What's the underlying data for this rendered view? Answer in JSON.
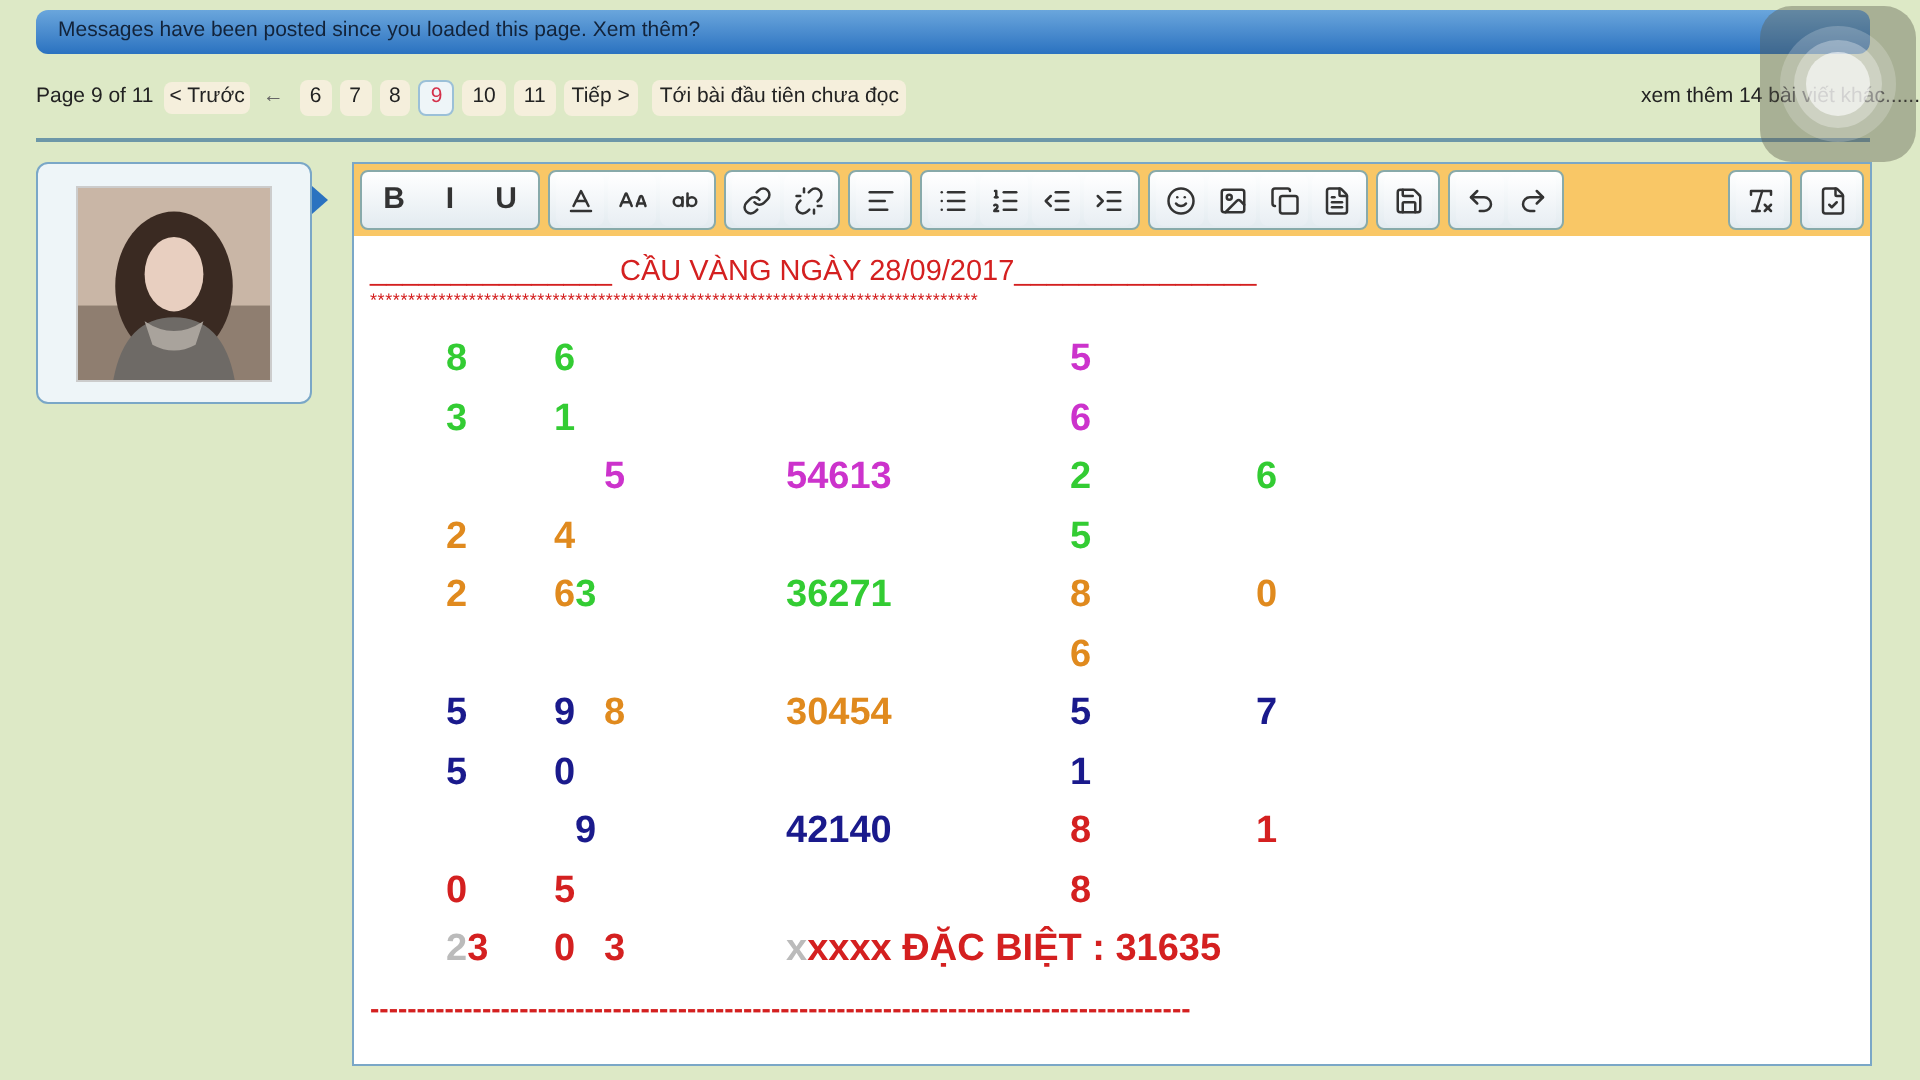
{
  "notice": {
    "text": "Messages have been posted since you loaded this page. Xem thêm?"
  },
  "pagination": {
    "label": "Page 9 of 11",
    "prev": "< Trước",
    "ellipsis": "←",
    "pages": [
      {
        "label": "6",
        "selected": false
      },
      {
        "label": "7",
        "selected": false
      },
      {
        "label": "8",
        "selected": false
      },
      {
        "label": "9",
        "selected": true
      },
      {
        "label": "10",
        "selected": false
      },
      {
        "label": "11",
        "selected": false
      }
    ],
    "next": "Tiếp >",
    "first_unread": "Tới bài đầu tiên chưa đọc",
    "more": "xem thêm 14 bài viết khác......"
  },
  "toolbar": {
    "format_buttons": [
      "B",
      "I",
      "U"
    ]
  },
  "post": {
    "title": "_______________ CẦU VÀNG NGÀY 28/09/2017_______________",
    "stars": "********************************************************************************",
    "rows": [
      {
        "column_1": [
          {
            "text": "8",
            "color": "#33cc33"
          }
        ],
        "column_2": [
          {
            "text": "6",
            "color": "#33cc33"
          }
        ],
        "column_5": [
          {
            "text": "5",
            "color": "#cc33cc"
          }
        ]
      },
      {
        "column_1": [
          {
            "text": "3",
            "color": "#33cc33"
          }
        ],
        "column_2": [
          {
            "text": "1",
            "color": "#33cc33"
          }
        ],
        "column_5": [
          {
            "text": "6",
            "color": "#cc33cc"
          }
        ]
      },
      {
        "column_3": [
          {
            "text": "5",
            "color": "#cc33cc"
          }
        ],
        "column_4": [
          {
            "text": "54613",
            "color": "#cc33cc"
          }
        ],
        "column_5": [
          {
            "text": "2",
            "color": "#33cc33"
          }
        ],
        "column_6": [
          {
            "text": "6",
            "color": "#33cc33"
          }
        ]
      },
      {
        "column_1": [
          {
            "text": "2",
            "color": "#e08a1e"
          }
        ],
        "column_2": [
          {
            "text": "4",
            "color": "#e08a1e"
          }
        ],
        "column_5": [
          {
            "text": "5",
            "color": "#33cc33"
          }
        ]
      },
      {
        "column_1": [
          {
            "text": "2",
            "color": "#e08a1e"
          }
        ],
        "column_2": [
          {
            "text": "6",
            "color": "#e08a1e"
          },
          {
            "text": "3",
            "color": "#33cc33"
          }
        ],
        "column_4": [
          {
            "text": "36271",
            "color": "#33cc33"
          }
        ],
        "column_5": [
          {
            "text": "8",
            "color": "#e08a1e"
          }
        ],
        "column_6": [
          {
            "text": "0",
            "color": "#e08a1e"
          }
        ]
      },
      {
        "column_5": [
          {
            "text": "6",
            "color": "#e08a1e"
          }
        ]
      },
      {
        "column_1": [
          {
            "text": "5",
            "color": "#1a1a8c"
          }
        ],
        "column_2": [
          {
            "text": "9",
            "color": "#1a1a8c"
          }
        ],
        "column_3": [
          {
            "text": "8",
            "color": "#e08a1e"
          }
        ],
        "column_4": [
          {
            "text": "30454",
            "color": "#e08a1e"
          }
        ],
        "column_5": [
          {
            "text": "5",
            "color": "#1a1a8c"
          }
        ],
        "column_6": [
          {
            "text": "7",
            "color": "#1a1a8c"
          }
        ]
      },
      {
        "column_1": [
          {
            "text": "5",
            "color": "#1a1a8c"
          }
        ],
        "column_2": [
          {
            "text": "0",
            "color": "#1a1a8c"
          }
        ],
        "column_5": [
          {
            "text": "1",
            "color": "#1a1a8c"
          }
        ]
      },
      {
        "column_2": [
          {
            "text": "  9",
            "color": "#1a1a8c"
          }
        ],
        "column_4": [
          {
            "text": "42140",
            "color": "#1a1a8c"
          }
        ],
        "column_5": [
          {
            "text": "8",
            "color": "#d42020"
          }
        ],
        "column_6": [
          {
            "text": "1",
            "color": "#d42020"
          }
        ]
      },
      {
        "column_1": [
          {
            "text": "0",
            "color": "#d42020"
          }
        ],
        "column_2": [
          {
            "text": "5",
            "color": "#d42020"
          }
        ],
        "column_5": [
          {
            "text": "8",
            "color": "#d42020"
          }
        ]
      },
      {
        "column_1": [
          {
            "text": "2",
            "color": "#bbbbbb"
          },
          {
            "text": "3",
            "color": "#d42020"
          }
        ],
        "column_2": [
          {
            "text": "0",
            "color": "#d42020"
          }
        ],
        "column_3": [
          {
            "text": "3",
            "color": "#d42020"
          }
        ],
        "column_4": [
          {
            "text": "x",
            "color": "#bbbbbb"
          },
          {
            "text": "xxxx ĐẶC BIỆT : 31635",
            "color": "#d42020"
          }
        ]
      }
    ],
    "dashes": "----------------------------------------------------------------------------------------"
  }
}
